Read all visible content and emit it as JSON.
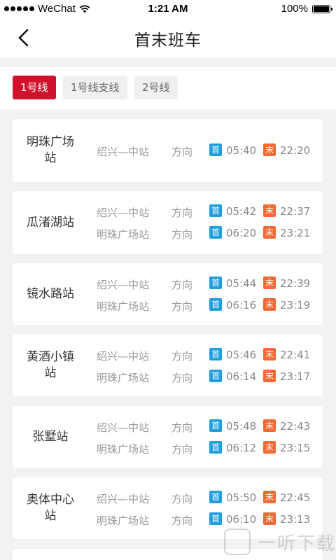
{
  "status_bar": {
    "carrier": "WeChat",
    "time": "1:21 AM",
    "battery": "100%"
  },
  "header": {
    "title": "首末班车"
  },
  "tabs": [
    {
      "label": "1号线",
      "active": true
    },
    {
      "label": "1号线支线",
      "active": false
    },
    {
      "label": "2号线",
      "active": false
    }
  ],
  "badges": {
    "first": "首",
    "last": "末"
  },
  "colors": {
    "accent": "#d0112b",
    "first_badge": "#1f9fe0",
    "last_badge": "#f06a35"
  },
  "stations": [
    {
      "name": "明珠广场站",
      "rows": [
        {
          "dest": "绍兴—中站",
          "dir": "方向",
          "first": "05:40",
          "last": "22:20"
        }
      ]
    },
    {
      "name": "瓜渚湖站",
      "rows": [
        {
          "dest": "绍兴—中站",
          "dir": "方向",
          "first": "05:42",
          "last": "22:37"
        },
        {
          "dest": "明珠广场站",
          "dir": "方向",
          "first": "06:20",
          "last": "23:21"
        }
      ]
    },
    {
      "name": "镜水路站",
      "rows": [
        {
          "dest": "绍兴—中站",
          "dir": "方向",
          "first": "05:44",
          "last": "22:39"
        },
        {
          "dest": "明珠广场站",
          "dir": "方向",
          "first": "06:16",
          "last": "23:19"
        }
      ]
    },
    {
      "name": "黄酒小镇站",
      "rows": [
        {
          "dest": "绍兴—中站",
          "dir": "方向",
          "first": "05:46",
          "last": "22:41"
        },
        {
          "dest": "明珠广场站",
          "dir": "方向",
          "first": "06:14",
          "last": "23:17"
        }
      ]
    },
    {
      "name": "张墅站",
      "rows": [
        {
          "dest": "绍兴—中站",
          "dir": "方向",
          "first": "05:48",
          "last": "22:43"
        },
        {
          "dest": "明珠广场站",
          "dir": "方向",
          "first": "06:12",
          "last": "23:15"
        }
      ]
    },
    {
      "name": "奥体中心站",
      "rows": [
        {
          "dest": "绍兴—中站",
          "dir": "方向",
          "first": "05:50",
          "last": "22:45"
        },
        {
          "dest": "明珠广场站",
          "dir": "方向",
          "first": "06:10",
          "last": "23:13"
        }
      ]
    }
  ],
  "watermark": {
    "text": "一听下载"
  }
}
